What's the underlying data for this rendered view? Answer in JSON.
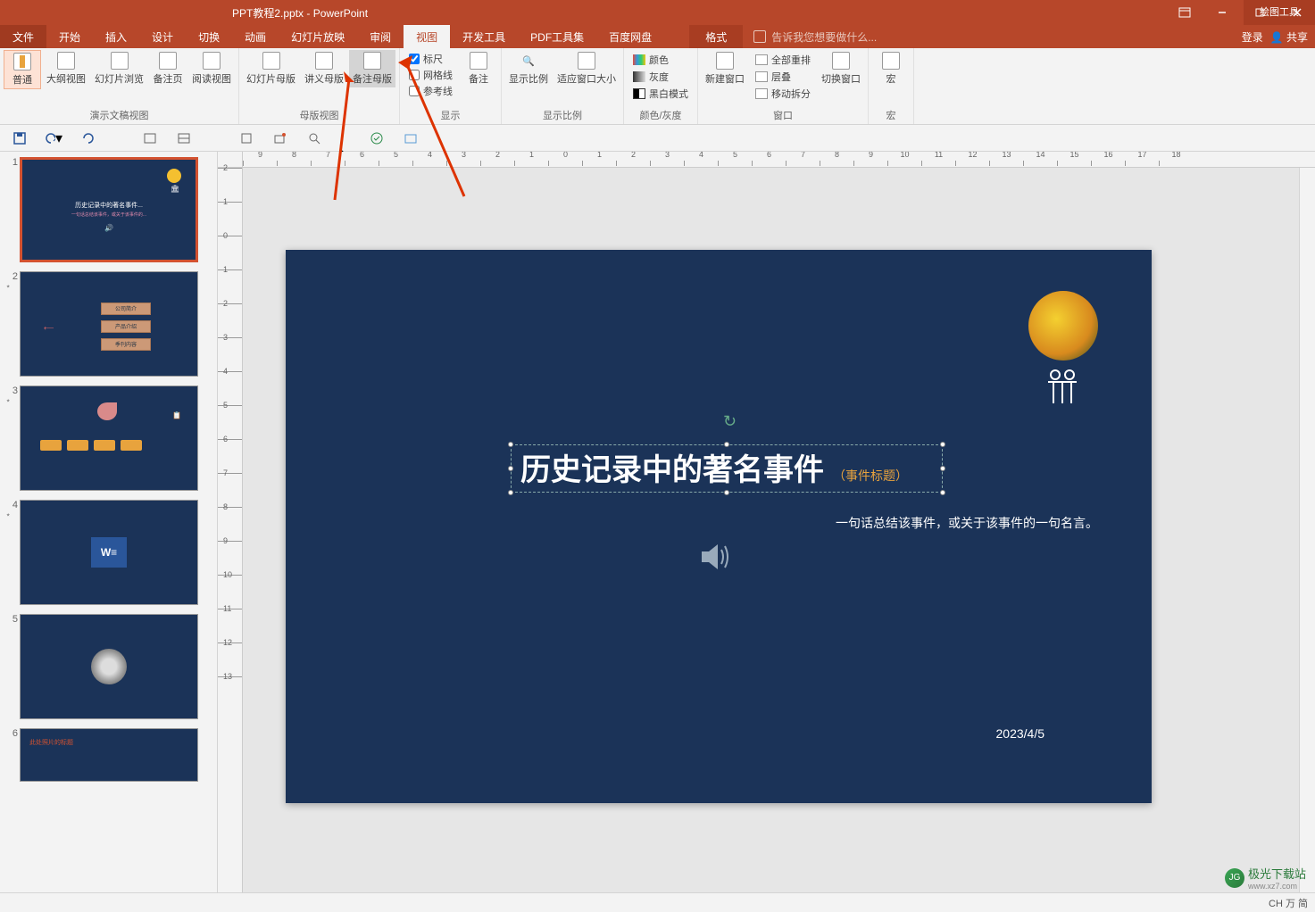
{
  "title_bar": {
    "filename": "PPT教程2.pptx - PowerPoint",
    "context_tab_group": "绘图工具"
  },
  "menu": {
    "file": "文件",
    "home": "开始",
    "insert": "插入",
    "design": "设计",
    "transitions": "切换",
    "animations": "动画",
    "slideshow": "幻灯片放映",
    "review": "审阅",
    "view": "视图",
    "developer": "开发工具",
    "pdf_tools": "PDF工具集",
    "baidu": "百度网盘",
    "format": "格式",
    "tell_me": "告诉我您想要做什么...",
    "login": "登录",
    "share": "共享"
  },
  "ribbon": {
    "group_presentation_views": {
      "label": "演示文稿视图",
      "normal": "普通",
      "outline": "大纲视图",
      "sorter": "幻灯片浏览",
      "notes_page": "备注页",
      "reading": "阅读视图"
    },
    "group_master_views": {
      "label": "母版视图",
      "slide_master": "幻灯片母版",
      "handout_master": "讲义母版",
      "notes_master": "备注母版"
    },
    "group_show": {
      "label": "显示",
      "ruler": "标尺",
      "gridlines": "网格线",
      "guides": "参考线",
      "notes": "备注"
    },
    "group_zoom": {
      "label": "显示比例",
      "zoom": "显示比例",
      "fit": "适应窗口大小"
    },
    "group_color": {
      "label": "颜色/灰度",
      "color": "颜色",
      "grayscale": "灰度",
      "bw": "黑白模式"
    },
    "group_window": {
      "label": "窗口",
      "new_window": "新建窗口",
      "arrange_all": "全部重排",
      "cascade": "层叠",
      "move_split": "移动拆分",
      "switch": "切换窗口"
    },
    "group_macros": {
      "label": "宏",
      "macros": "宏"
    }
  },
  "ruler_h": [
    "9",
    "8",
    "7",
    "6",
    "5",
    "4",
    "3",
    "2",
    "1",
    "0",
    "1",
    "2",
    "3",
    "4",
    "5",
    "6",
    "7",
    "8",
    "9",
    "10",
    "11",
    "12",
    "13",
    "14",
    "15",
    "16",
    "17",
    "18"
  ],
  "ruler_v": [
    "2",
    "1",
    "0",
    "1",
    "2",
    "3",
    "4",
    "5",
    "6",
    "7",
    "8",
    "9",
    "10",
    "11",
    "12",
    "13"
  ],
  "slide": {
    "title": "历史记录中的著名事件",
    "title_suffix": "（事件标题）",
    "subtitle": "一句话总结该事件，或关于该事件的一句名言。",
    "date": "2023/4/5"
  },
  "thumbs": [
    {
      "num": "1",
      "star": false
    },
    {
      "num": "2",
      "star": true
    },
    {
      "num": "3",
      "star": true
    },
    {
      "num": "4",
      "star": true
    },
    {
      "num": "5",
      "star": false
    },
    {
      "num": "6",
      "star": false
    }
  ],
  "thumb_content": {
    "t1_title": "历史记录中的著名事件...",
    "t1_sub": "一句话总结该事件，或关于该事件的...",
    "t2_box1": "公司简介",
    "t2_box2": "产品介绍",
    "t2_box3": "季刊内容",
    "t6_hdr": "此处照片的标题"
  },
  "watermark": {
    "name": "极光下载站",
    "url": "www.xz7.com"
  },
  "ime": "CH 万 简"
}
